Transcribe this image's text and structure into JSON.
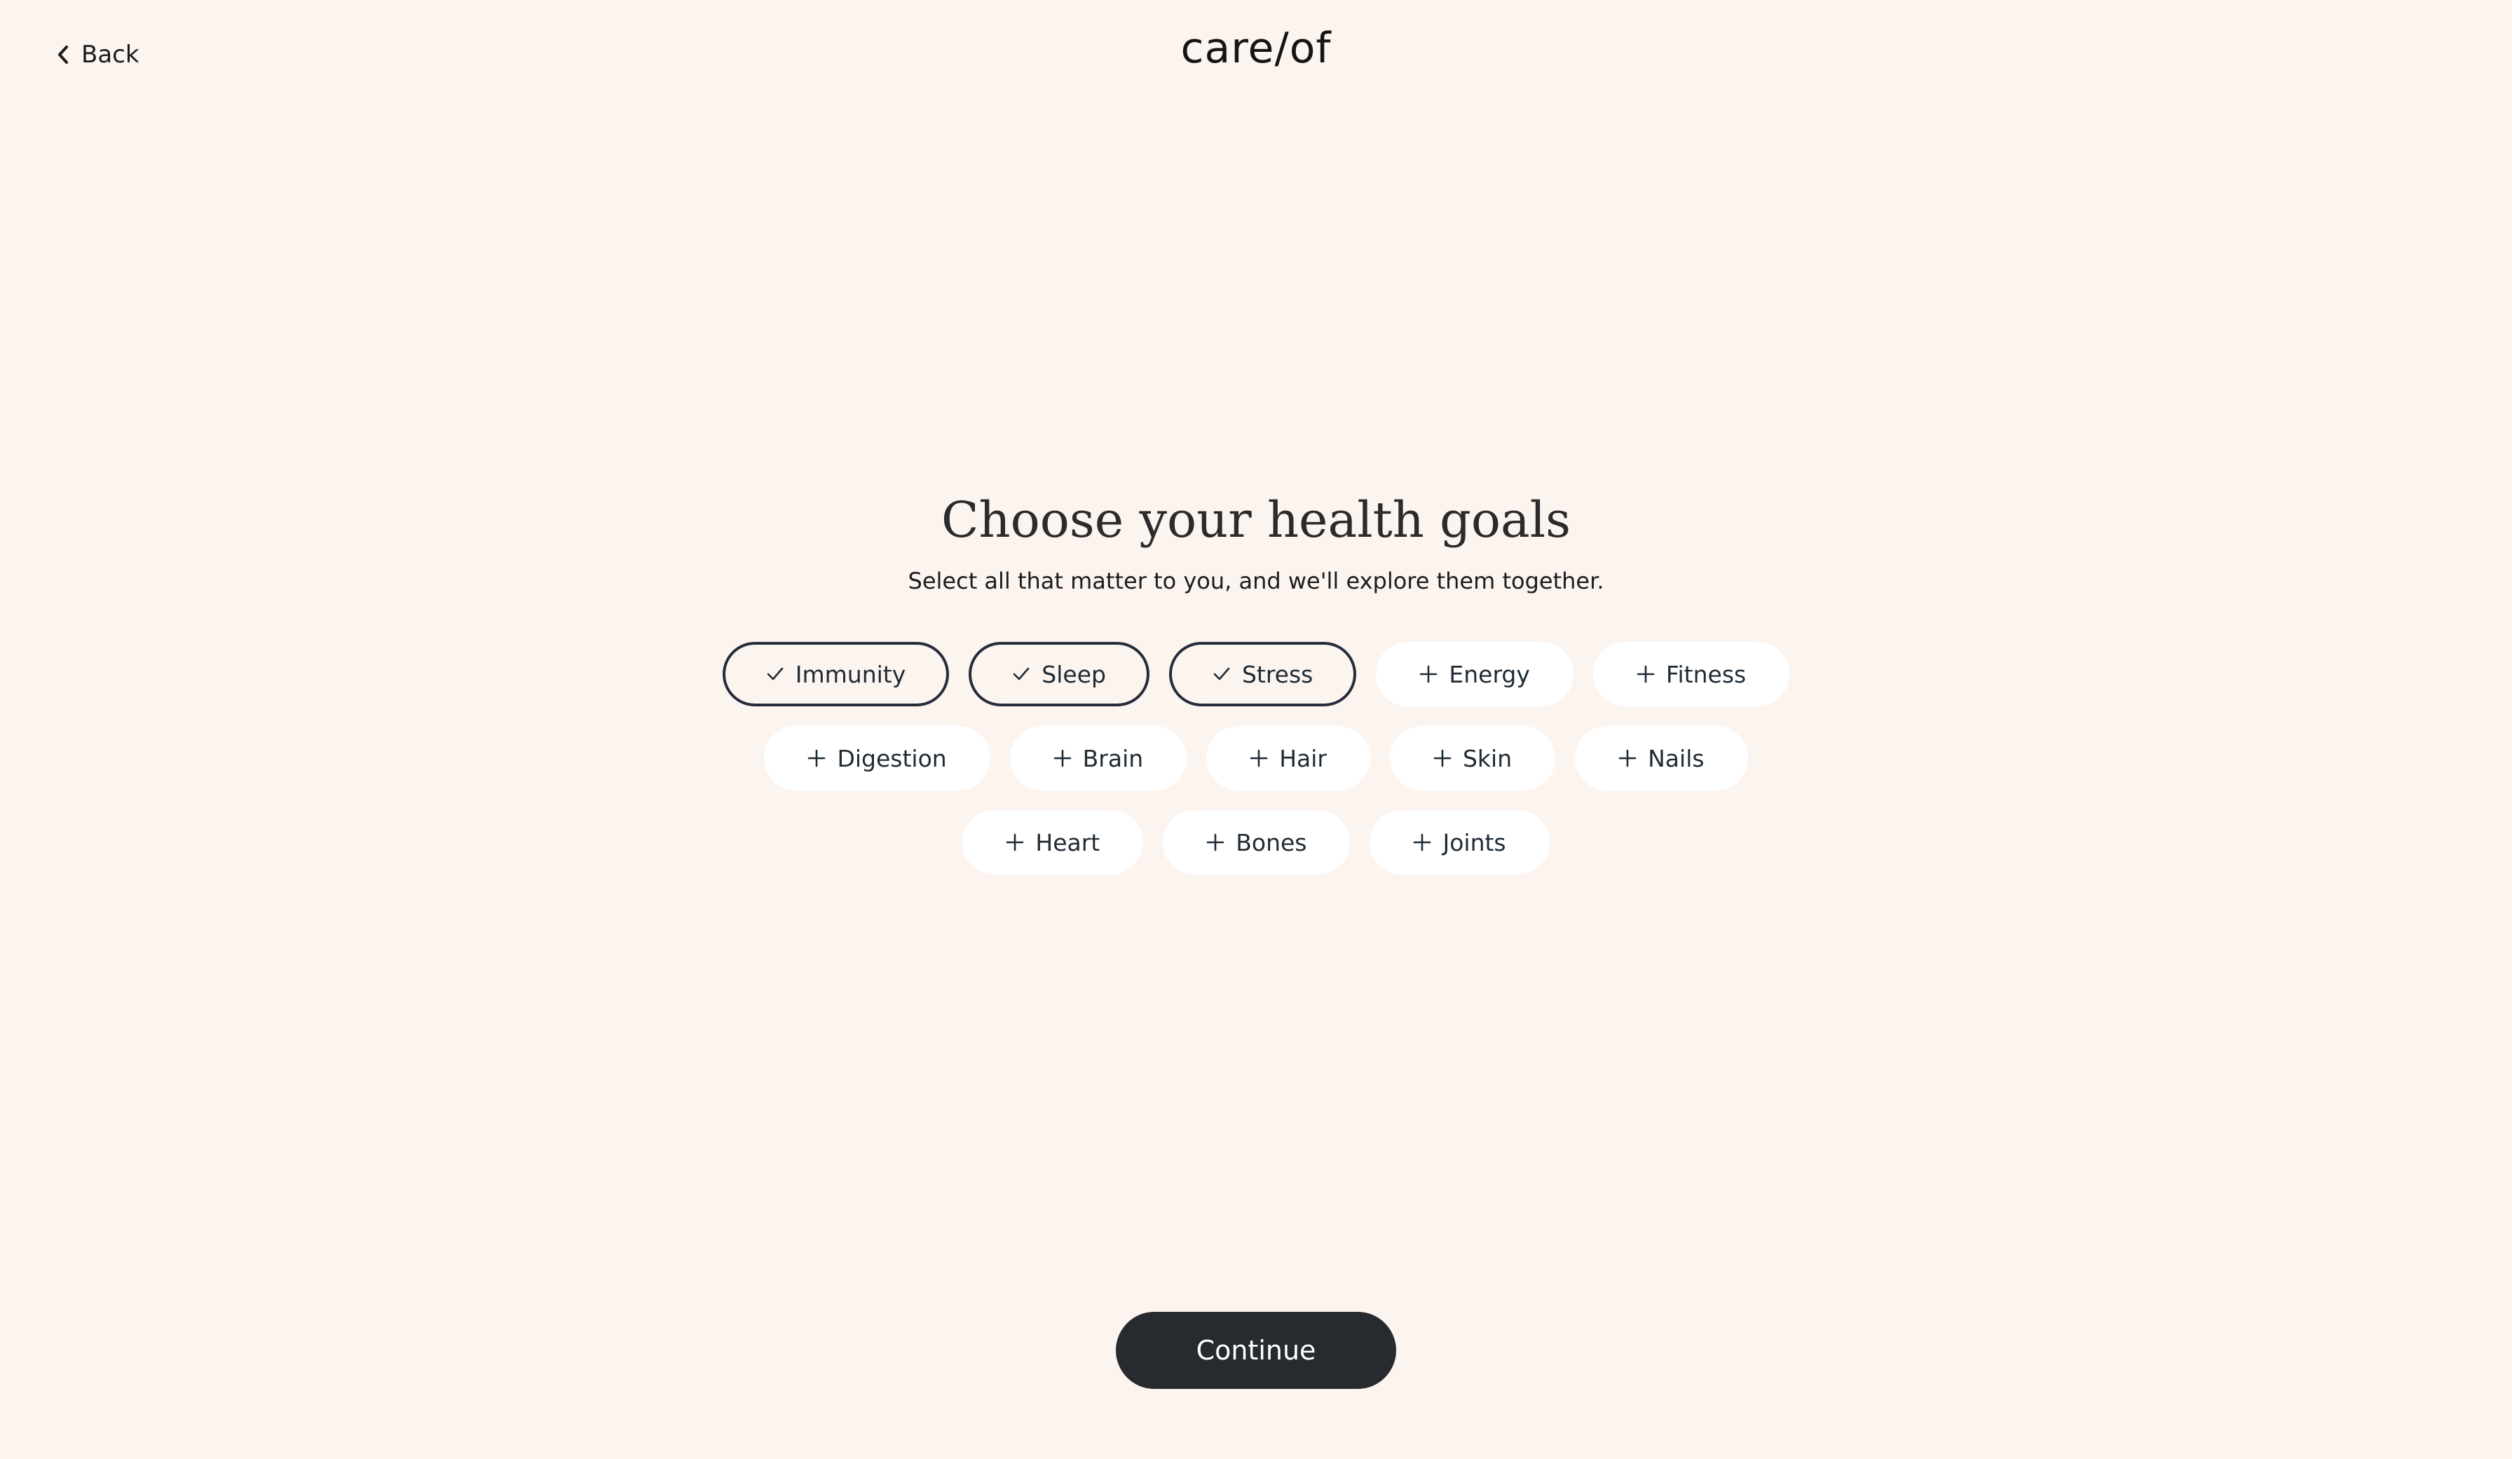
{
  "header": {
    "back_label": "Back",
    "logo_text": "care/of"
  },
  "main": {
    "title": "Choose your health goals",
    "subtitle": "Select all that matter to you, and we'll explore them together.",
    "goal_rows": [
      [
        {
          "label": "Immunity",
          "selected": true,
          "icon": "check-icon"
        },
        {
          "label": "Sleep",
          "selected": true,
          "icon": "check-icon"
        },
        {
          "label": "Stress",
          "selected": true,
          "icon": "check-icon"
        },
        {
          "label": "Energy",
          "selected": false,
          "icon": "plus-icon"
        },
        {
          "label": "Fitness",
          "selected": false,
          "icon": "plus-icon"
        }
      ],
      [
        {
          "label": "Digestion",
          "selected": false,
          "icon": "plus-icon"
        },
        {
          "label": "Brain",
          "selected": false,
          "icon": "plus-icon"
        },
        {
          "label": "Hair",
          "selected": false,
          "icon": "plus-icon"
        },
        {
          "label": "Skin",
          "selected": false,
          "icon": "plus-icon"
        },
        {
          "label": "Nails",
          "selected": false,
          "icon": "plus-icon"
        }
      ],
      [
        {
          "label": "Heart",
          "selected": false,
          "icon": "plus-icon"
        },
        {
          "label": "Bones",
          "selected": false,
          "icon": "plus-icon"
        },
        {
          "label": "Joints",
          "selected": false,
          "icon": "plus-icon"
        }
      ]
    ]
  },
  "footer": {
    "continue_label": "Continue"
  },
  "colors": {
    "background": "#fcf4ef",
    "pill_background": "#ffffff",
    "selected_border": "#252d3a",
    "button_background": "#272b2f",
    "button_text": "#ffffff"
  }
}
